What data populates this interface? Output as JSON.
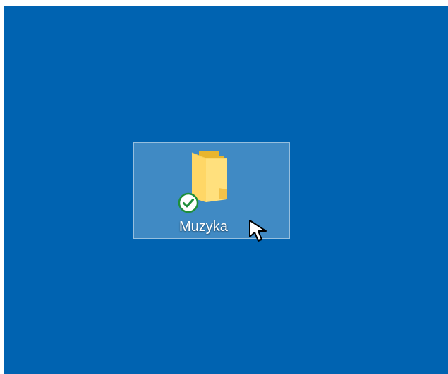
{
  "desktop": {
    "background_color": "#0063b1",
    "items": [
      {
        "label": "Muzyka",
        "icon": "folder-icon",
        "badge": "sync-status-ok-icon",
        "state": "hover"
      }
    ]
  },
  "cursor": {
    "icon": "arrow-pointer-icon"
  }
}
